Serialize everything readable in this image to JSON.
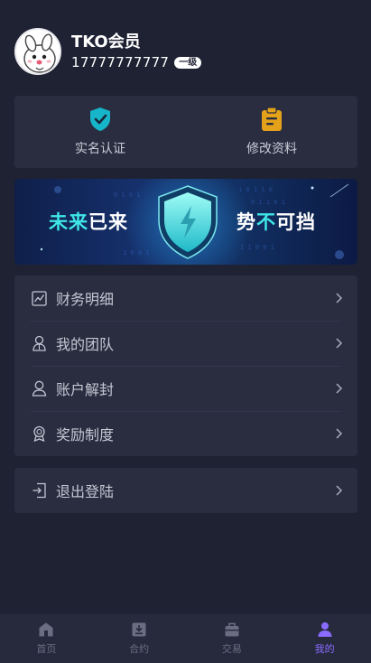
{
  "profile": {
    "name": "TKO会员",
    "phone": "17777777777",
    "level": "一级"
  },
  "quick_actions": [
    {
      "label": "实名认证",
      "icon": "shield-check-icon",
      "color": "#17b5c9"
    },
    {
      "label": "修改资料",
      "icon": "clipboard-icon",
      "color": "#e3a21a"
    }
  ],
  "banner": {
    "left_accent": "未来",
    "left_rest": "已来",
    "right_start": "势",
    "right_accent": "不",
    "right_rest": "可挡"
  },
  "menu": [
    {
      "label": "财务明细",
      "icon": "finance-chart-icon"
    },
    {
      "label": "我的团队",
      "icon": "team-icon"
    },
    {
      "label": "账户解封",
      "icon": "user-unlock-icon"
    },
    {
      "label": "奖励制度",
      "icon": "award-icon"
    }
  ],
  "logout": {
    "label": "退出登陆",
    "icon": "logout-icon"
  },
  "tabbar": [
    {
      "label": "首页",
      "icon": "home-icon",
      "active": false
    },
    {
      "label": "合约",
      "icon": "contract-icon",
      "active": false
    },
    {
      "label": "交易",
      "icon": "trade-icon",
      "active": false
    },
    {
      "label": "我的",
      "icon": "user-icon",
      "active": true
    }
  ],
  "colors": {
    "background": "#1f2233",
    "card": "#2a2d40",
    "tab_active": "#8a6bff",
    "tab_inactive": "#6b6e82",
    "banner_accent": "#3fe6e6"
  }
}
